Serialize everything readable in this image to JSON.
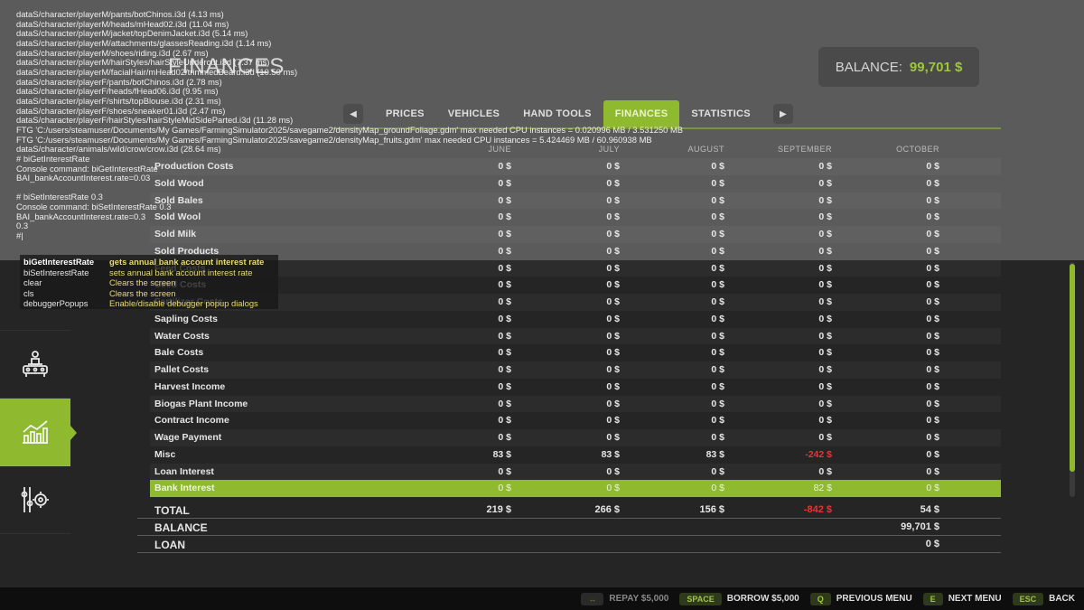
{
  "page_title": "FINANCES",
  "balance": {
    "label": "BALANCE:",
    "value": "99,701 $"
  },
  "tabs": [
    {
      "label": "PRICES"
    },
    {
      "label": "VEHICLES"
    },
    {
      "label": "HAND TOOLS"
    },
    {
      "label": "FINANCES"
    },
    {
      "label": "STATISTICS"
    }
  ],
  "active_tab": "FINANCES",
  "months": [
    "JUNE",
    "JULY",
    "AUGUST",
    "SEPTEMBER",
    "OCTOBER"
  ],
  "rows": [
    {
      "label": "Production Costs",
      "values": [
        "0 $",
        "0 $",
        "0 $",
        "0 $",
        "0 $"
      ]
    },
    {
      "label": "Sold Wood",
      "values": [
        "0 $",
        "0 $",
        "0 $",
        "0 $",
        "0 $"
      ]
    },
    {
      "label": "Sold Bales",
      "values": [
        "0 $",
        "0 $",
        "0 $",
        "0 $",
        "0 $"
      ]
    },
    {
      "label": "Sold Wool",
      "values": [
        "0 $",
        "0 $",
        "0 $",
        "0 $",
        "0 $"
      ]
    },
    {
      "label": "Sold Milk",
      "values": [
        "0 $",
        "0 $",
        "0 $",
        "0 $",
        "0 $"
      ]
    },
    {
      "label": "Sold Products",
      "values": [
        "0 $",
        "0 $",
        "0 $",
        "0 $",
        "0 $"
      ]
    },
    {
      "label": "Feed Costs",
      "values": [
        "0 $",
        "0 $",
        "0 $",
        "0 $",
        "0 $"
      ]
    },
    {
      "label": "Seed Costs",
      "values": [
        "0 $",
        "0 $",
        "0 $",
        "0 $",
        "0 $"
      ]
    },
    {
      "label": "Fertilizer Costs",
      "values": [
        "0 $",
        "0 $",
        "0 $",
        "0 $",
        "0 $"
      ]
    },
    {
      "label": "Sapling Costs",
      "values": [
        "0 $",
        "0 $",
        "0 $",
        "0 $",
        "0 $"
      ]
    },
    {
      "label": "Water Costs",
      "values": [
        "0 $",
        "0 $",
        "0 $",
        "0 $",
        "0 $"
      ]
    },
    {
      "label": "Bale Costs",
      "values": [
        "0 $",
        "0 $",
        "0 $",
        "0 $",
        "0 $"
      ]
    },
    {
      "label": "Pallet Costs",
      "values": [
        "0 $",
        "0 $",
        "0 $",
        "0 $",
        "0 $"
      ]
    },
    {
      "label": "Harvest Income",
      "values": [
        "0 $",
        "0 $",
        "0 $",
        "0 $",
        "0 $"
      ]
    },
    {
      "label": "Biogas Plant Income",
      "values": [
        "0 $",
        "0 $",
        "0 $",
        "0 $",
        "0 $"
      ]
    },
    {
      "label": "Contract Income",
      "values": [
        "0 $",
        "0 $",
        "0 $",
        "0 $",
        "0 $"
      ]
    },
    {
      "label": "Wage Payment",
      "values": [
        "0 $",
        "0 $",
        "0 $",
        "0 $",
        "0 $"
      ]
    },
    {
      "label": "Misc",
      "values": [
        "83 $",
        "83 $",
        "83 $",
        "-242 $",
        "0 $"
      ]
    },
    {
      "label": "Loan Interest",
      "values": [
        "0 $",
        "0 $",
        "0 $",
        "0 $",
        "0 $"
      ]
    },
    {
      "label": "Bank Interest",
      "values": [
        "0 $",
        "0 $",
        "0 $",
        "82 $",
        "0 $"
      ]
    }
  ],
  "highlight_row": "Bank Interest",
  "totals": [
    {
      "label": "TOTAL",
      "values": [
        "219 $",
        "266 $",
        "156 $",
        "-842 $",
        "54 $"
      ]
    },
    {
      "label": "BALANCE",
      "values": [
        "",
        "",
        "",
        "",
        "99,701 $"
      ]
    },
    {
      "label": "LOAN",
      "values": [
        "",
        "",
        "",
        "",
        "0 $"
      ]
    }
  ],
  "console_lines": [
    "dataS/character/playerM/pants/botChinos.i3d (4.13 ms)",
    "dataS/character/playerM/heads/mHead02.i3d (11.04 ms)",
    "dataS/character/playerM/jacket/topDenimJacket.i3d (5.14 ms)",
    "dataS/character/playerM/attachments/glassesReading.i3d (1.14 ms)",
    "dataS/character/playerM/shoes/riding.i3d (2.67 ms)",
    "dataS/character/playerM/hairStyles/hairStyleUndercut.i3d (7.37 ms)",
    "dataS/character/playerM/facialHair/mHead02/trimmedBeard.i3d (10.50 ms)",
    "dataS/character/playerF/pants/botChinos.i3d (2.78 ms)",
    "dataS/character/playerF/heads/fHead06.i3d (9.95 ms)",
    "dataS/character/playerF/shirts/topBlouse.i3d (2.31 ms)",
    "dataS/character/playerF/shoes/sneaker01.i3d (2.47 ms)",
    "dataS/character/playerF/hairStyles/hairStyleMidSideParted.i3d (11.28 ms)",
    "FTG 'C:/users/steamuser/Documents/My Games/FarmingSimulator2025/savegame2/densityMap_groundFoliage.gdm' max needed CPU instances = 0.020996 MB / 3.531250 MB",
    "FTG 'C:/users/steamuser/Documents/My Games/FarmingSimulator2025/savegame2/densityMap_fruits.gdm' max needed CPU instances = 5.424469 MB / 60.960938 MB",
    "dataS/character/animals/wild/crow/crow.i3d (28.64 ms)",
    "# biGetInterestRate",
    "Console command: biGetInterestRate",
    "BAI_bankAccountInterest.rate=0.03",
    "",
    "# biSetInterestRate 0.3",
    "Console command: biSetInterestRate 0.3",
    "BAI_bankAccountInterest.rate=0.3",
    "0.3",
    "#|"
  ],
  "autocomplete": [
    {
      "cmd": "biGetInterestRate",
      "desc": "gets annual bank account interest rate",
      "selected": true
    },
    {
      "cmd": "biSetInterestRate",
      "desc": "sets annual bank account interest rate",
      "selected": false
    },
    {
      "cmd": "clear",
      "desc": "Clears the screen",
      "selected": false
    },
    {
      "cmd": "cls",
      "desc": "Clears the screen",
      "selected": false
    },
    {
      "cmd": "debuggerPopups",
      "desc": "Enable/disable debugger popup dialogs",
      "selected": false
    }
  ],
  "footer": [
    {
      "key": "↔",
      "label": "REPAY $5,000",
      "dim": true
    },
    {
      "key": "SPACE",
      "label": "BORROW $5,000",
      "dim": false
    },
    {
      "key": "Q",
      "label": "PREVIOUS MENU",
      "dim": false
    },
    {
      "key": "E",
      "label": "NEXT MENU",
      "dim": false
    },
    {
      "key": "ESC",
      "label": "BACK",
      "dim": false
    }
  ],
  "colors": {
    "accent": "#8fb92f",
    "negative": "#e83535",
    "balance_value": "#9ec73c"
  },
  "sidebar_icons": [
    "production-icon",
    "finances-chart-icon",
    "settings-gear-icon"
  ]
}
